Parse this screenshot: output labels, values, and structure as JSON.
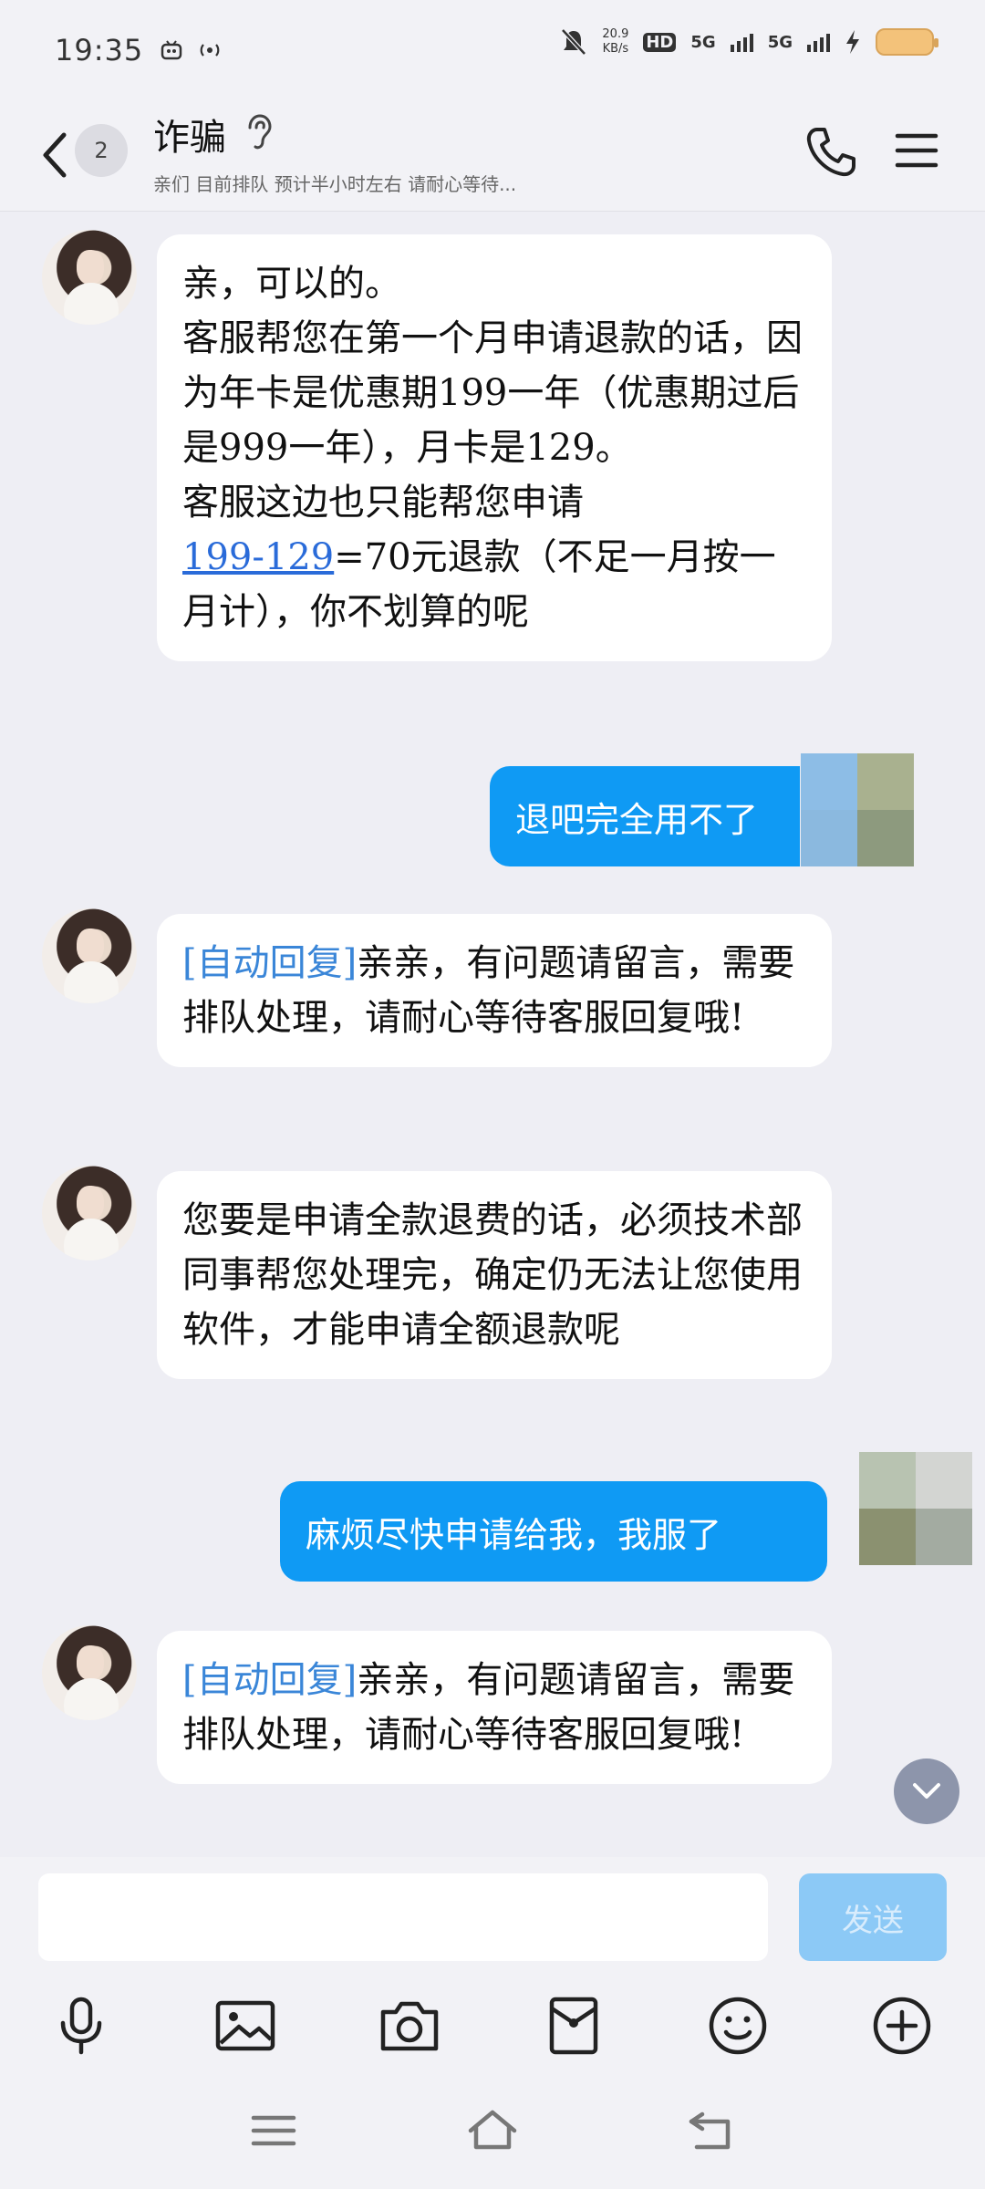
{
  "status_bar": {
    "time": "19:35",
    "net_speed": "20.9",
    "net_unit": "KB/s",
    "hd_label": "HD",
    "sim1": "5G",
    "sim2": "5G"
  },
  "header": {
    "unread_count": "2",
    "title": "诈骗",
    "subtitle": "亲们 目前排队 预计半小时左右 请耐心等待..."
  },
  "messages": [
    {
      "direction": "in",
      "lines": [
        "亲，可以的。",
        "客服帮您在第一个月申请退款的话，因为年卡是优惠期199一年（优惠期过后是999一年），月卡是129。",
        "客服这边也只能帮您申请"
      ],
      "link_text": "199-129",
      "after_link": "=70元退款（不足一月按一月计），你不划算的呢"
    },
    {
      "direction": "out",
      "text": "退吧完全用不了"
    },
    {
      "direction": "in",
      "auto_tag": "[自动回复]",
      "text": "亲亲，有问题请留言，需要排队处理，请耐心等待客服回复哦!"
    },
    {
      "direction": "in",
      "text": "您要是申请全款退费的话，必须技术部同事帮您处理完，确定仍无法让您使用软件，才能申请全额退款呢"
    },
    {
      "direction": "out",
      "text": "麻烦尽快申请给我，我服了"
    },
    {
      "direction": "in",
      "auto_tag": "[自动回复]",
      "text": "亲亲，有问题请留言，需要排队处理，请耐心等待客服回复哦!"
    }
  ],
  "input": {
    "value": "",
    "send_label": "发送"
  },
  "toolbar": {
    "icons": [
      "microphone-icon",
      "image-icon",
      "camera-icon",
      "red-packet-icon",
      "emoji-icon",
      "plus-icon"
    ]
  },
  "nav": {
    "icons": [
      "menu-icon",
      "home-icon",
      "back-icon"
    ]
  },
  "colors": {
    "accent": "#0f9af4",
    "link": "#2a6bd9",
    "background": "#eeeef4"
  }
}
